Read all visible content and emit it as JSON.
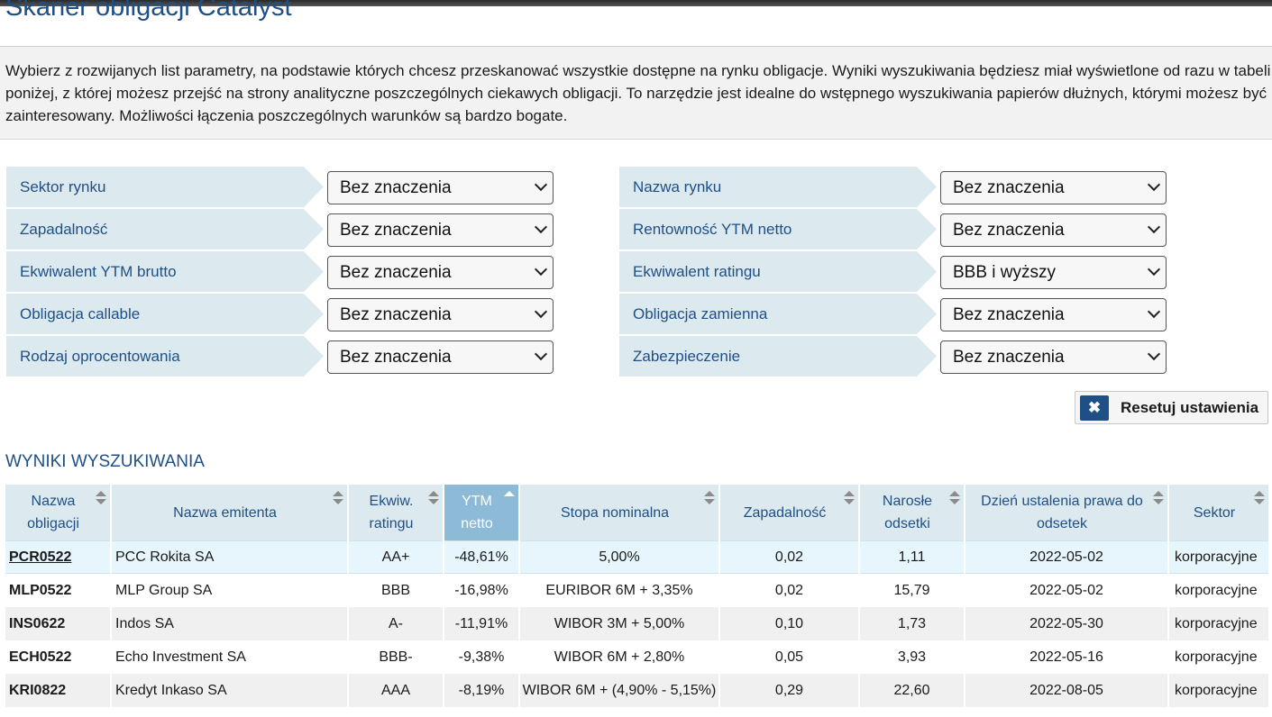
{
  "page": {
    "title": "Skaner obligacji Catalyst",
    "intro": "Wybierz z rozwijanych list parametry, na podstawie których chcesz przeskanować wszystkie dostępne na rynku obligacje. Wyniki wyszukiwania będziesz miał wyświetlone od razu w tabeli poniżej, z której możesz przejść na strony analityczne poszczególnych ciekawych obligacji. To narzędzie jest idealne do wstępnego wyszukiwania papierów dłużnych, którymi możesz być zainteresowany. Możliwości łączenia poszczególnych warunków są bardzo bogate."
  },
  "filters": {
    "left": [
      {
        "label": "Sektor rynku",
        "value": "Bez znaczenia"
      },
      {
        "label": "Zapadalność",
        "value": "Bez znaczenia"
      },
      {
        "label": "Ekwiwalent YTM brutto",
        "value": "Bez znaczenia"
      },
      {
        "label": "Obligacja callable",
        "value": "Bez znaczenia"
      },
      {
        "label": "Rodzaj oprocentowania",
        "value": "Bez znaczenia"
      }
    ],
    "right": [
      {
        "label": "Nazwa rynku",
        "value": "Bez znaczenia"
      },
      {
        "label": "Rentowność YTM netto",
        "value": "Bez znaczenia"
      },
      {
        "label": "Ekwiwalent ratingu",
        "value": "BBB i wyższy"
      },
      {
        "label": "Obligacja zamienna",
        "value": "Bez znaczenia"
      },
      {
        "label": "Zabezpieczenie",
        "value": "Bez znaczenia"
      }
    ],
    "reset_label": "Resetuj ustawienia",
    "reset_icon": "close-icon"
  },
  "results": {
    "heading": "WYNIKI WYSZUKIWANIA",
    "columns": [
      "Nazwa obligacji",
      "Nazwa emitenta",
      "Ekwiw. ratingu",
      "YTM netto",
      "Stopa nominalna",
      "Zapadalność",
      "Narosłe odsetki",
      "Dzień ustalenia prawa do odsetek",
      "Sektor"
    ],
    "active_sort_column": "YTM netto",
    "rows": [
      [
        "PCR0522",
        "PCC Rokita SA",
        "AA+",
        "-48,61%",
        "5,00%",
        "0,02",
        "1,11",
        "2022-05-02",
        "korporacyjne"
      ],
      [
        "MLP0522",
        "MLP Group SA",
        "BBB",
        "-16,98%",
        "EURIBOR 6M + 3,35%",
        "0,02",
        "15,79",
        "2022-05-02",
        "korporacyjne"
      ],
      [
        "INS0622",
        "Indos SA",
        "A-",
        "-11,91%",
        "WIBOR 3M + 5,00%",
        "0,10",
        "1,73",
        "2022-05-30",
        "korporacyjne"
      ],
      [
        "ECH0522",
        "Echo Investment SA",
        "BBB-",
        "-9,38%",
        "WIBOR 6M + 2,80%",
        "0,05",
        "3,93",
        "2022-05-16",
        "korporacyjne"
      ],
      [
        "KRI0822",
        "Kredyt Inkaso SA",
        "AAA",
        "-8,19%",
        "WIBOR 6M + (4,90% - 5,15%)",
        "0,29",
        "22,60",
        "2022-08-05",
        "korporacyjne"
      ]
    ]
  },
  "colors": {
    "accent": "#1e4f86",
    "label_bg": "#dce9ef",
    "active_header_bg": "#8dbad6",
    "highlight_row_bg": "#e6f6fc"
  }
}
